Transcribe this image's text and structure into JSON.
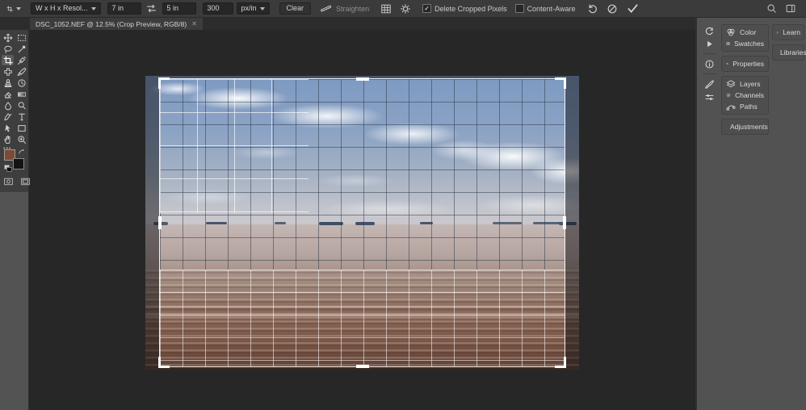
{
  "options_bar": {
    "preset_label": "W x H x Resol...",
    "width_value": "7 in",
    "height_value": "5 in",
    "resolution_value": "300",
    "resolution_unit": "px/in",
    "clear_label": "Clear",
    "straighten_label": "Straighten",
    "delete_pixels_label": "Delete Cropped Pixels",
    "delete_pixels_checked": true,
    "content_aware_label": "Content-Aware",
    "content_aware_checked": false,
    "check_glyph": "✓"
  },
  "tab": {
    "title": "DSC_1052.NEF @ 12.5% (Crop Preview, RGB/8)",
    "close_glyph": "✕"
  },
  "toolbar": {
    "more_glyph": "•••",
    "selected_tool": "crop",
    "foreground_color": "#7c4a37",
    "background_color": "#131313",
    "tools": [
      "move",
      "marquee",
      "lasso",
      "quick-selection",
      "crop",
      "eyedropper",
      "healing-brush",
      "brush",
      "clone-stamp",
      "history-brush",
      "eraser",
      "gradient",
      "blur",
      "dodge",
      "pen",
      "type",
      "path-selection",
      "rectangle",
      "hand",
      "zoom"
    ]
  },
  "panels": {
    "color": "Color",
    "swatches": "Swatches",
    "properties": "Properties",
    "layers": "Layers",
    "channels": "Channels",
    "paths": "Paths",
    "adjustments": "Adjustments",
    "learn": "Learn",
    "libraries": "Libraries"
  },
  "crop": {
    "overlay_grid": true,
    "handles": [
      "top-left",
      "top",
      "top-right",
      "left",
      "right",
      "bottom-left",
      "bottom",
      "bottom-right"
    ]
  }
}
